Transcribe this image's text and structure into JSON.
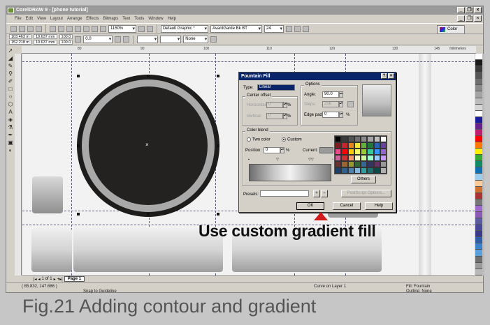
{
  "window": {
    "title": "CorelDRAW 9 - [phone tutorial]",
    "buttons": [
      "_",
      "❐",
      "×"
    ]
  },
  "menu": [
    "File",
    "Edit",
    "View",
    "Layout",
    "Arrange",
    "Effects",
    "Bitmaps",
    "Text",
    "Tools",
    "Window",
    "Help"
  ],
  "toolbar": {
    "zoom": "1150%",
    "style": "Default Graphic *",
    "font": "AvantGarde Bk BT",
    "font_size": "24",
    "color_button": "Color"
  },
  "propbar": {
    "x": "103.463 m",
    "y": "152.218 m",
    "w": "19.637 mm",
    "h": "19.637 mm",
    "sx": "100.0",
    "sy": "100.0",
    "angle": "0.0",
    "outline": "None"
  },
  "ruler_labels": [
    "80",
    "90",
    "100",
    "110",
    "120",
    "130",
    "140",
    "145"
  ],
  "ruler_unit": "millimeters",
  "dialog": {
    "title": "Fountain Fill",
    "type_label": "Type:",
    "type_value": "Linear",
    "center_offset": "Center offset",
    "horizontal": "Horizontal:",
    "vertical": "Vertical:",
    "horizontal_value": "0",
    "vertical_value": "0",
    "options": "Options",
    "angle_label": "Angle:",
    "angle_value": "90.0",
    "steps_label": "Steps:",
    "steps_value": "256",
    "edge_label": "Edge pad:",
    "edge_value": "0",
    "percent": "%",
    "color_blend": "Color blend",
    "two_color": "Two color",
    "custom": "Custom",
    "position_label": "Position:",
    "position_value": "0",
    "current_label": "Current:",
    "others": "Others",
    "presets_label": "Presets:",
    "postscript": "PostScript Options...",
    "ok": "OK",
    "cancel": "Cancel",
    "help": "Help",
    "plus": "+",
    "minus": "−",
    "palette_colors": [
      "#000000",
      "#3a3a3a",
      "#555555",
      "#707070",
      "#8a8a8a",
      "#a5a5a5",
      "#c0c0c0",
      "#ffffff",
      "#7a1f1f",
      "#c1272d",
      "#e8821e",
      "#f6e43b",
      "#5fb13c",
      "#1f7a3a",
      "#2a63b0",
      "#6a3fa0",
      "#e84c8a",
      "#ff0000",
      "#ffcc00",
      "#ffff66",
      "#99cc33",
      "#33cc99",
      "#3399ff",
      "#9966cc",
      "#cc6699",
      "#cc3333",
      "#ff9966",
      "#ffffcc",
      "#ccff99",
      "#99ffcc",
      "#99ccff",
      "#cc99ff",
      "#663333",
      "#996633",
      "#999933",
      "#336633",
      "#336699",
      "#333366",
      "#663366",
      "#999999",
      "#1e3f66",
      "#2f5f8a",
      "#4a82b4",
      "#86b6dc",
      "#2ea0a0",
      "#1e6e6e",
      "#0f4a4a",
      "#b0b0b0"
    ]
  },
  "annotation": "Use custom gradient fill",
  "caption": "Fig.21  Adding contour and gradient",
  "page": {
    "counter": "1 of 1",
    "tab": "Page 1"
  },
  "status": {
    "coords": "( 85.832, 147.686 )",
    "snap": "Snap to Guideline",
    "object": "Curve on Layer 1",
    "fill": "Fill: Fountain",
    "outline": "Outline: None"
  },
  "palette_strip": [
    "#ffffff",
    "#1a1a1a",
    "#3a3a3a",
    "#555555",
    "#6e6e6e",
    "#8a8a8a",
    "#a3a3a3",
    "#bcbcbc",
    "#d5d5d5",
    "#ffffff",
    "#1c1c9a",
    "#6a1f8f",
    "#c21c6e",
    "#ff0000",
    "#ff7700",
    "#ffee00",
    "#33aa33",
    "#118866",
    "#0f6fb0",
    "#99ccee",
    "#ffcc99",
    "#d07030",
    "#aa3333",
    "#777777",
    "#a06ad0",
    "#8c5ab4",
    "#5a5aa0",
    "#48489a",
    "#3a3a88",
    "#2e5ea8",
    "#3c82c8",
    "#5aa0dc",
    "#6f6f6f",
    "#9a9a9a",
    "#b8b8b8"
  ]
}
